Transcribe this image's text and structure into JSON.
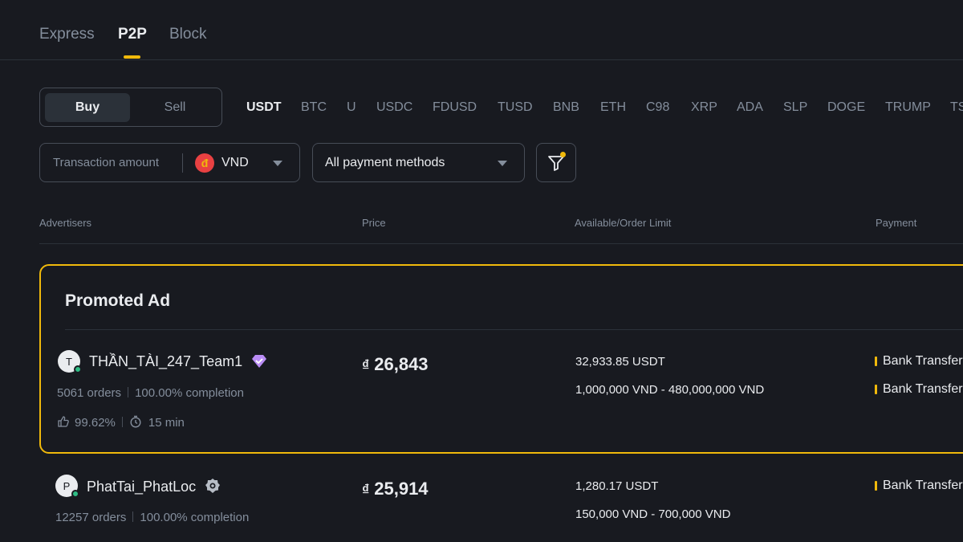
{
  "tabs": [
    {
      "label": "Express"
    },
    {
      "label": "P2P",
      "active": true
    },
    {
      "label": "Block"
    }
  ],
  "trade_toggle": {
    "buy_label": "Buy",
    "sell_label": "Sell",
    "selected": "Buy"
  },
  "coins": [
    "USDT",
    "BTC",
    "U",
    "USDC",
    "FDUSD",
    "TUSD",
    "BNB",
    "ETH",
    "C98",
    "XRP",
    "ADA",
    "SLP",
    "DOGE",
    "TRUMP",
    "TS"
  ],
  "selected_coin": "USDT",
  "filters": {
    "amount_placeholder": "Transaction amount",
    "currency_symbol": "đ",
    "currency": "VND",
    "payment_method": "All payment methods"
  },
  "table_headers": {
    "advertisers": "Advertisers",
    "price": "Price",
    "limit": "Available/Order Limit",
    "payment": "Payment"
  },
  "promoted": {
    "title": "Promoted Ad",
    "ad": {
      "avatar_letter": "T",
      "name": "THẦN_TÀI_247_Team1",
      "badge_icon": "verified-diamond-icon",
      "orders": "5061 orders",
      "completion": "100.00% completion",
      "rating": "99.62%",
      "release_time": "15 min",
      "currency_symbol": "₫",
      "price": "26,843",
      "available": "32,933.85 USDT",
      "limit": "1,000,000 VND - 480,000,000 VND",
      "payments": [
        "Bank Transfer",
        "Bank Transfer"
      ]
    }
  },
  "ads": [
    {
      "avatar_letter": "P",
      "name": "PhatTai_PhatLoc",
      "badge_icon": "merchant-badge-icon",
      "orders": "12257 orders",
      "completion": "100.00% completion",
      "currency_symbol": "₫",
      "price": "25,914",
      "available": "1,280.17 USDT",
      "limit": "150,000 VND - 700,000 VND",
      "payments": [
        "Bank Transfer"
      ]
    }
  ],
  "colors": {
    "background": "#181a20",
    "accent": "#f0b90b",
    "text": "#eaecef",
    "muted": "#848e9c",
    "online": "#2ebd85"
  }
}
